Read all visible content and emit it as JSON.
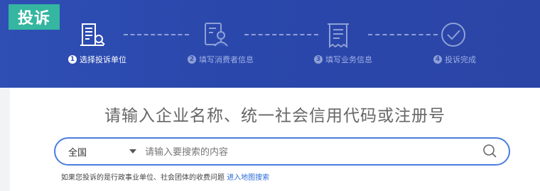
{
  "tag": "投诉",
  "steps": [
    {
      "num": "1",
      "label": "选择投诉单位",
      "icon": "building-search-icon",
      "active": true
    },
    {
      "num": "2",
      "label": "填写消费者信息",
      "icon": "person-form-icon",
      "active": false
    },
    {
      "num": "3",
      "label": "填写业务信息",
      "icon": "receipt-icon",
      "active": false
    },
    {
      "num": "4",
      "label": "投诉完成",
      "icon": "check-circle-icon",
      "active": false
    }
  ],
  "headline": "请输入企业名称、统一社会信用代码或注册号",
  "search": {
    "region": "全国",
    "placeholder": "请输入要搜索的内容"
  },
  "hint": {
    "text": "如果您投诉的是行政事业单位、社会团体的收费问题",
    "link": "进入地图搜索"
  },
  "colors": {
    "banner": "#2f4fb4",
    "tag": "#35b6a0",
    "accent": "#4a7de0"
  }
}
